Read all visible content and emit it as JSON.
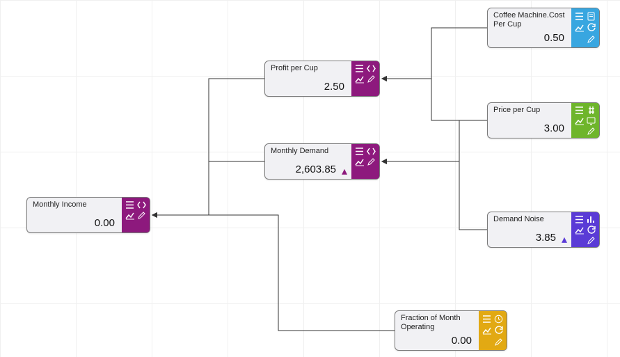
{
  "nodes": {
    "monthly_income": {
      "title": "Monthly Income",
      "value": "0.00"
    },
    "profit_per_cup": {
      "title": "Profit per Cup",
      "value": "2.50"
    },
    "monthly_demand": {
      "title": "Monthly Demand",
      "value": "2,603.85"
    },
    "cost_per_cup": {
      "title": "Coffee Machine.Cost Per Cup",
      "value": "0.50"
    },
    "price_per_cup": {
      "title": "Price per Cup",
      "value": "3.00"
    },
    "demand_noise": {
      "title": "Demand Noise",
      "value": "3.85"
    },
    "fraction_op": {
      "title": "Fraction of Month Operating",
      "value": "0.00"
    }
  },
  "icons": {
    "menu": "menu-icon",
    "code": "code-icon",
    "chart": "chart-icon",
    "edit": "edit-icon",
    "page": "page-icon",
    "refresh": "refresh-icon",
    "hash": "hash-icon",
    "screen": "screen-icon",
    "bars": "bars-icon",
    "clock": "clock-icon"
  }
}
